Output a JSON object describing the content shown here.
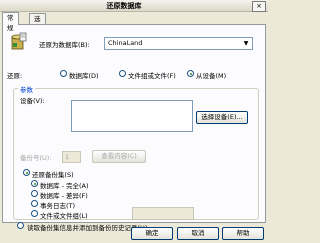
{
  "window": {
    "title": "还原数据库",
    "close_glyph": "×"
  },
  "tabs": [
    {
      "label": "常规"
    },
    {
      "label": "选项"
    }
  ],
  "restore_target": {
    "label": "还原为数据库(B):",
    "value": "ChinaLand",
    "icon": "database-icon"
  },
  "restore_from": {
    "label": "还原:",
    "options": [
      {
        "label": "数据库(D)",
        "selected": false
      },
      {
        "label": "文件组或文件(F)",
        "selected": false
      },
      {
        "label": "从设备(M)",
        "selected": true
      }
    ]
  },
  "params": {
    "legend": "参数",
    "devices_label": "设备(V):",
    "select_devices_button": "选择设备(E)...",
    "backup_number_label": "备份号(U):",
    "backup_number_value": "1",
    "view_contents_button": "查看内容(C)",
    "restore_backup_set": {
      "label": "还原备份集(S)",
      "selected": true,
      "options": [
        {
          "label": "数据库 - 完全(A)",
          "selected": true
        },
        {
          "label": "数据库 - 差异(F)",
          "selected": false
        },
        {
          "label": "事务日志(T)",
          "selected": false
        },
        {
          "label": "文件或文件组(L)",
          "selected": false
        }
      ]
    },
    "read_backup_set": {
      "label": "读取备份集信息并添加到备份历史记录(H)",
      "selected": false
    }
  },
  "footer": {
    "ok": "确定",
    "cancel": "取消",
    "help": "帮助"
  }
}
